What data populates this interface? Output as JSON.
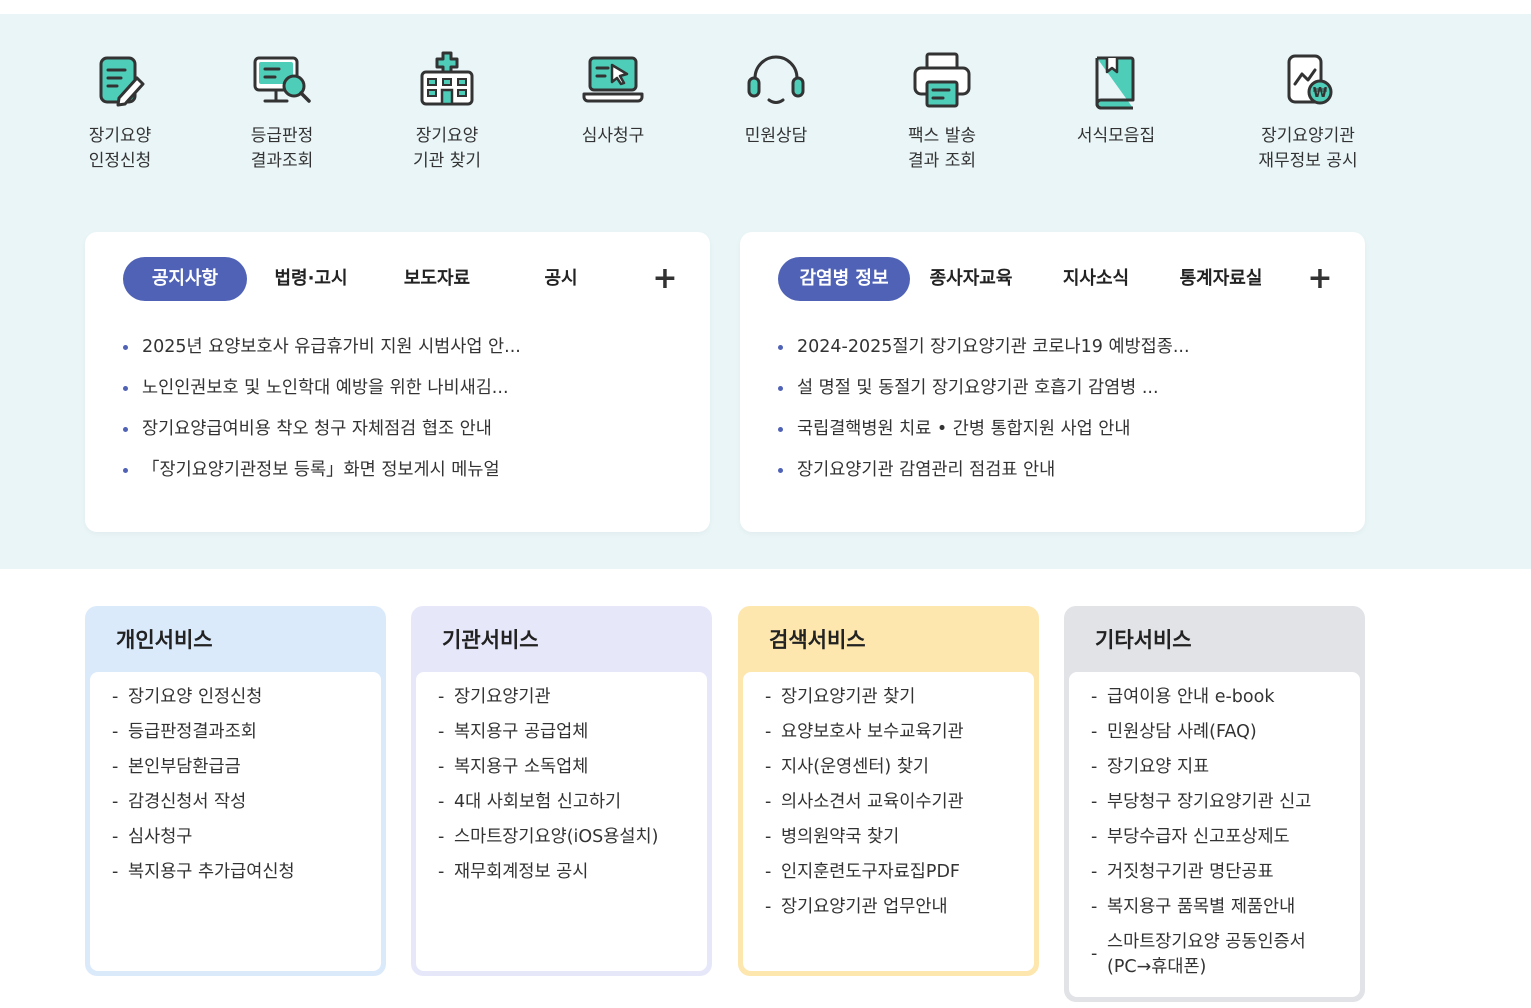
{
  "colors": {
    "band": "#e9f5f7",
    "accent": "#4f62b6",
    "icon_fill": "#4ecdb8",
    "icon_stroke": "#333333"
  },
  "quick_menu": [
    {
      "label": "장기요양\n인정신청",
      "icon": "document-pen-icon"
    },
    {
      "label": "등급판정\n결과조회",
      "icon": "monitor-search-icon"
    },
    {
      "label": "장기요양\n기관 찾기",
      "icon": "hospital-icon"
    },
    {
      "label": "심사청구",
      "icon": "laptop-cursor-icon"
    },
    {
      "label": "민원상담",
      "icon": "headset-icon"
    },
    {
      "label": "팩스 발송\n결과 조회",
      "icon": "printer-icon"
    },
    {
      "label": "서식모음집",
      "icon": "book-icon"
    },
    {
      "label": "장기요양기관\n재무정보 공시",
      "icon": "financial-chart-won-icon"
    }
  ],
  "board_left": {
    "tabs": [
      "공지사항",
      "법령·고시",
      "보도자료",
      "공시"
    ],
    "active_tab": 0,
    "more": "+",
    "items": [
      "2025년 요양보호사 유급휴가비 지원 시범사업 안...",
      "노인인권보호 및 노인학대 예방을 위한 나비새김...",
      "장기요양급여비용 착오 청구 자체점검 협조 안내",
      "「장기요양기관정보 등록」화면 정보게시 메뉴얼"
    ]
  },
  "board_right": {
    "tabs": [
      "감염병 정보",
      "종사자교육",
      "지사소식",
      "통계자료실"
    ],
    "active_tab": 0,
    "more": "+",
    "items": [
      "2024-2025절기 장기요양기관 코로나19 예방접종...",
      "설 명절 및 동절기 장기요양기관 호흡기 감염병 ...",
      "국립결핵병원 치료 • 간병 통합지원 사업 안내",
      "장기요양기관 감염관리 점검표 안내"
    ]
  },
  "services": [
    {
      "title": "개인서비스",
      "color": "#dbeafb",
      "items": [
        "장기요양 인정신청",
        "등급판정결과조회",
        "본인부담환급금",
        "감경신청서 작성",
        "심사청구",
        "복지용구 추가급여신청"
      ]
    },
    {
      "title": "기관서비스",
      "color": "#e6e8fa",
      "items": [
        "장기요양기관",
        "복지용구 공급업체",
        "복지용구 소독업체",
        "4대 사회보험 신고하기",
        "스마트장기요양(iOS용설치)",
        "재무회계정보 공시"
      ]
    },
    {
      "title": "검색서비스",
      "color": "#fde7ae",
      "items": [
        "장기요양기관 찾기",
        "요양보호사 보수교육기관",
        "지사(운영센터) 찾기",
        "의사소견서 교육이수기관",
        "병의원약국 찾기",
        "인지훈련도구자료집PDF",
        "장기요양기관 업무안내"
      ]
    },
    {
      "title": "기타서비스",
      "color": "#e2e3e7",
      "items": [
        "급여이용 안내 e-book",
        "민원상담 사례(FAQ)",
        "장기요양 지표",
        "부당청구 장기요양기관 신고",
        "부당수급자 신고포상제도",
        "거짓청구기관 명단공표",
        "복지용구 품목별 제품안내",
        "스마트장기요양 공동인증서\n(PC→휴대폰)"
      ]
    }
  ]
}
